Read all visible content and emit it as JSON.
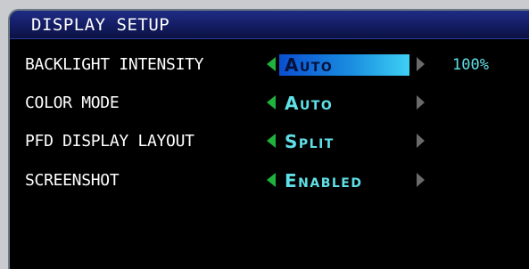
{
  "window": {
    "title": "DISPLAY SETUP"
  },
  "settings": [
    {
      "label": "BACKLIGHT INTENSITY",
      "value": "Auto",
      "extra": "100%",
      "selected": true
    },
    {
      "label": "COLOR MODE",
      "value": "Auto",
      "extra": "",
      "selected": false
    },
    {
      "label": "PFD DISPLAY LAYOUT",
      "value": "Split",
      "extra": "",
      "selected": false
    },
    {
      "label": "SCREENSHOT",
      "value": "Enabled",
      "extra": "",
      "selected": false
    }
  ],
  "icons": {
    "left": "chevron-left-icon",
    "right": "chevron-right-icon"
  },
  "colors": {
    "title_bar": "#131c62",
    "label_text": "#ffffff",
    "value_text": "#5fe0e6",
    "left_arrow": "#1fb23d",
    "right_arrow": "#6a6a6a",
    "selection_start": "#0a4fd1",
    "selection_end": "#3ed0f4",
    "background": "#000000"
  }
}
